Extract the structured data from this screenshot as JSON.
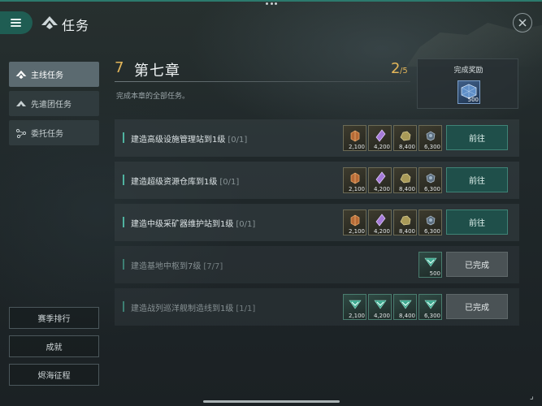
{
  "header": {
    "title": "任务",
    "menu_icon": "menu-icon",
    "title_icon": "fleet-emblem-icon",
    "close_icon": "close-icon"
  },
  "sidebar": {
    "items": [
      {
        "label": "主线任务",
        "icon": "fleet-emblem-icon",
        "active": true
      },
      {
        "label": "先遣团任务",
        "icon": "vanguard-icon",
        "active": false
      },
      {
        "label": "委托任务",
        "icon": "network-icon",
        "active": false
      }
    ],
    "bottom_buttons": [
      {
        "label": "赛季排行"
      },
      {
        "label": "成就"
      },
      {
        "label": "烬海征程"
      }
    ]
  },
  "chapter": {
    "number": "7",
    "title": "第七章",
    "progress_current": "2",
    "progress_total": "/5",
    "progress_fraction": 0.4,
    "description": "完成本章的全部任务。"
  },
  "chapter_reward": {
    "label": "完成奖励",
    "item_icon": "blueprint-cube-icon",
    "quantity": "500"
  },
  "quests": [
    {
      "text": "建造高级设施管理站到1级",
      "count": "[0/1]",
      "status": "active",
      "button": "前往",
      "rewards": [
        {
          "icon": "metal-crate-icon",
          "quantity": "2,100"
        },
        {
          "icon": "crystal-icon",
          "quantity": "4,200"
        },
        {
          "icon": "ore-icon",
          "quantity": "8,400"
        },
        {
          "icon": "fuel-icon",
          "quantity": "6,300"
        }
      ]
    },
    {
      "text": "建造超级资源仓库到1级",
      "count": "[0/1]",
      "status": "active",
      "button": "前往",
      "rewards": [
        {
          "icon": "metal-crate-icon",
          "quantity": "2,100"
        },
        {
          "icon": "crystal-icon",
          "quantity": "4,200"
        },
        {
          "icon": "ore-icon",
          "quantity": "8,400"
        },
        {
          "icon": "fuel-icon",
          "quantity": "6,300"
        }
      ]
    },
    {
      "text": "建造中级采矿器维护站到1级",
      "count": "[0/1]",
      "status": "active",
      "button": "前往",
      "rewards": [
        {
          "icon": "metal-crate-icon",
          "quantity": "2,100"
        },
        {
          "icon": "crystal-icon",
          "quantity": "4,200"
        },
        {
          "icon": "ore-icon",
          "quantity": "8,400"
        },
        {
          "icon": "fuel-icon",
          "quantity": "6,300"
        }
      ]
    },
    {
      "text": "建造基地中枢到7级",
      "count": "[7/7]",
      "status": "completed",
      "button": "已完成",
      "rewards": [
        {
          "icon": "claimed-check-icon",
          "quantity": "500"
        }
      ]
    },
    {
      "text": "建造战列巡洋舰制造线到1级",
      "count": "[1/1]",
      "status": "completed",
      "button": "已完成",
      "rewards": [
        {
          "icon": "claimed-check-icon",
          "quantity": "2,100"
        },
        {
          "icon": "claimed-check-icon",
          "quantity": "4,200"
        },
        {
          "icon": "claimed-check-icon",
          "quantity": "8,400"
        },
        {
          "icon": "claimed-check-icon",
          "quantity": "6,300"
        }
      ]
    }
  ],
  "colors": {
    "accent": "#e3b65a",
    "teal": "#1f5d53",
    "go_button": "#1f4f4a",
    "done_button": "#4a5255"
  }
}
